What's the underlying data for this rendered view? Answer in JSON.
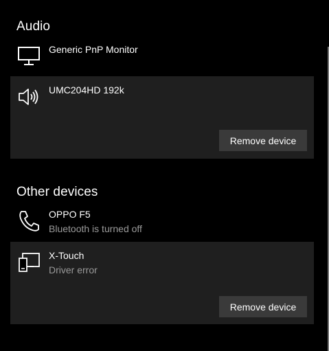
{
  "sections": {
    "audio": {
      "title": "Audio",
      "devices": [
        {
          "name": "Generic PnP Monitor",
          "icon": "monitor-icon"
        },
        {
          "name": "UMC204HD 192k",
          "icon": "speaker-icon",
          "button_label": "Remove device"
        }
      ]
    },
    "other": {
      "title": "Other devices",
      "devices": [
        {
          "name": "OPPO F5",
          "status": "Bluetooth is turned off",
          "icon": "phone-icon"
        },
        {
          "name": "X-Touch",
          "status": "Driver error",
          "icon": "devices-icon",
          "button_label": "Remove device"
        }
      ]
    }
  },
  "colors": {
    "background": "#000000",
    "selected_item": "#1f1f1f",
    "button": "#3a3a3a",
    "secondary_text": "#9a9a9a"
  }
}
